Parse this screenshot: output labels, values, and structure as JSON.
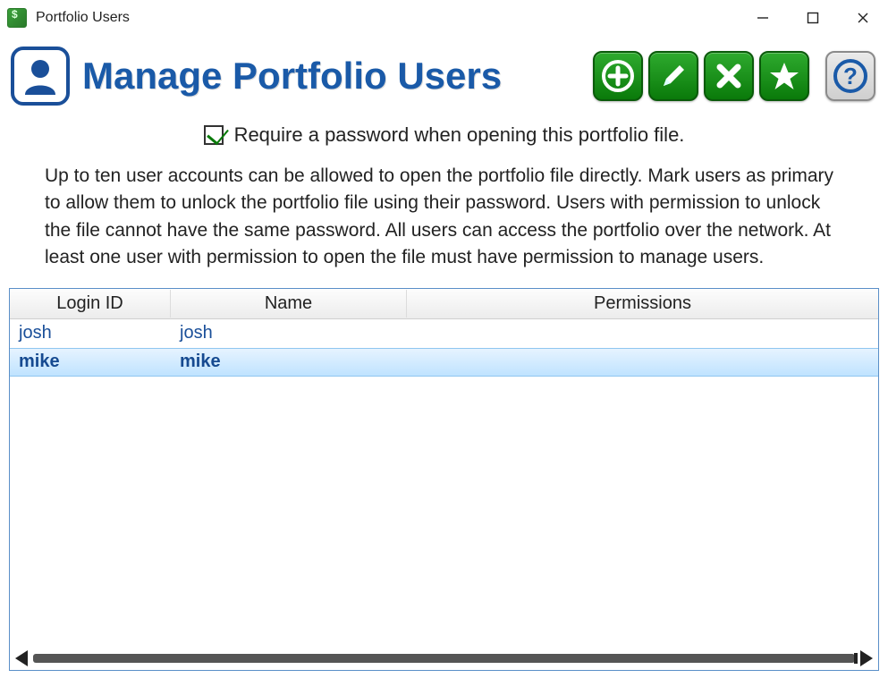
{
  "window": {
    "title": "Portfolio Users"
  },
  "header": {
    "title": "Manage Portfolio Users"
  },
  "checkbox": {
    "label": "Require a password when opening this portfolio file.",
    "checked": true
  },
  "description": "Up to ten user accounts can be allowed to open the portfolio file directly. Mark users as primary to allow them to unlock the portfolio file using their password. Users with permission to unlock the file cannot have the same password. All users can access the portfolio over the network. At least one user with permission to open the file must have permission to manage users.",
  "table": {
    "columns": {
      "login": "Login ID",
      "name": "Name",
      "permissions": "Permissions"
    },
    "rows": [
      {
        "login": "josh",
        "name": "josh",
        "permissions": "",
        "selected": false
      },
      {
        "login": "mike",
        "name": "mike",
        "permissions": "",
        "selected": true
      }
    ]
  }
}
